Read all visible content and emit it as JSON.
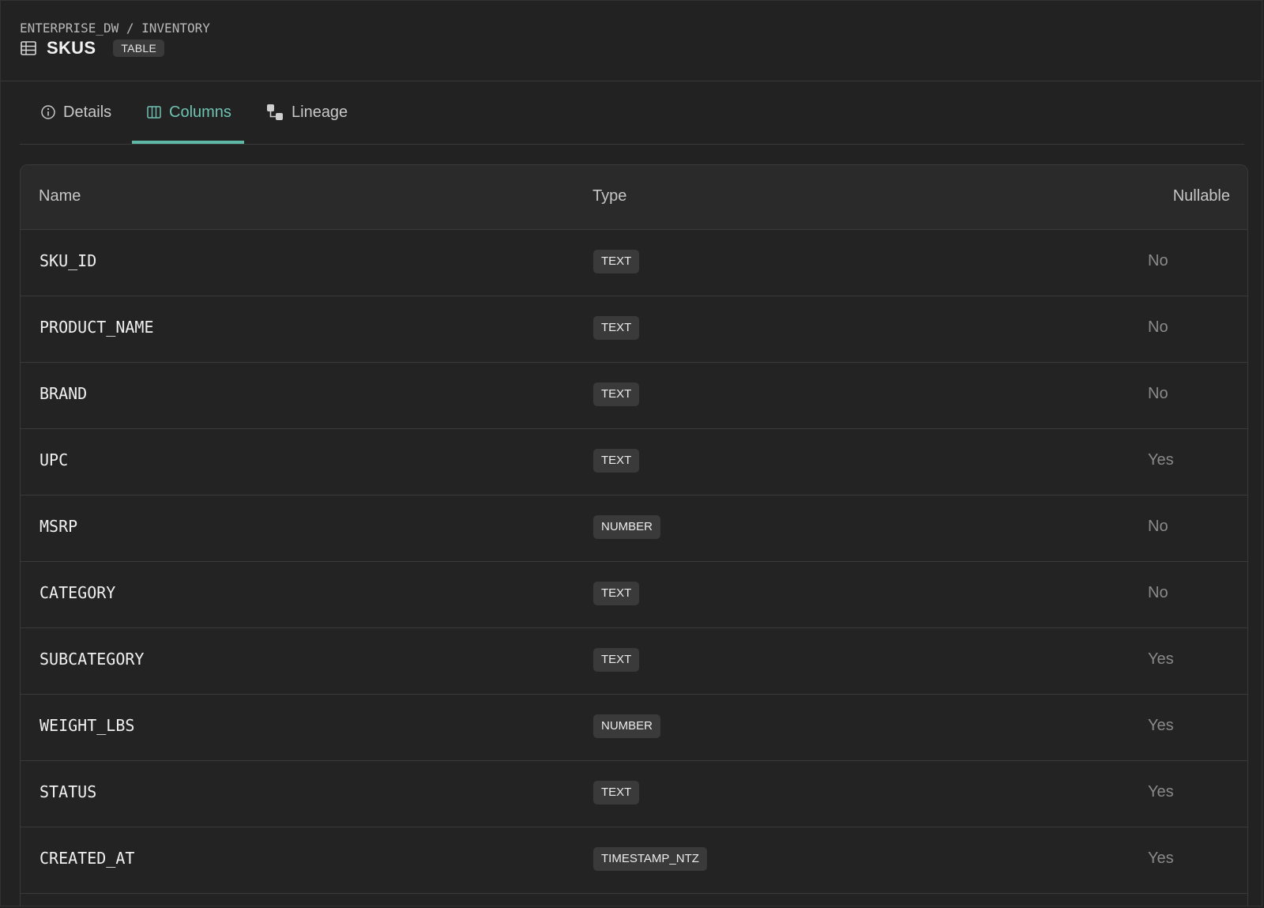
{
  "breadcrumb": {
    "database": "ENTERPRISE_DW",
    "separator": "/",
    "schema": "INVENTORY"
  },
  "header": {
    "title": "SKUS",
    "kind_badge": "TABLE",
    "icon": "table-grid-icon"
  },
  "tabs": [
    {
      "label": "Details",
      "icon": "info-circle-icon",
      "active": false
    },
    {
      "label": "Columns",
      "icon": "columns-icon",
      "active": true
    },
    {
      "label": "Lineage",
      "icon": "lineage-icon",
      "active": false
    }
  ],
  "colors": {
    "background": "#222222",
    "accent": "#5fb8a6",
    "badge_bg": "#3a3a3a",
    "muted_text": "#8a8a8a"
  },
  "columns_table": {
    "headers": {
      "name": "Name",
      "type": "Type",
      "nullable": "Nullable"
    },
    "rows": [
      {
        "name": "SKU_ID",
        "type": "TEXT",
        "nullable": "No"
      },
      {
        "name": "PRODUCT_NAME",
        "type": "TEXT",
        "nullable": "No"
      },
      {
        "name": "BRAND",
        "type": "TEXT",
        "nullable": "No"
      },
      {
        "name": "UPC",
        "type": "TEXT",
        "nullable": "Yes"
      },
      {
        "name": "MSRP",
        "type": "NUMBER",
        "nullable": "No"
      },
      {
        "name": "CATEGORY",
        "type": "TEXT",
        "nullable": "No"
      },
      {
        "name": "SUBCATEGORY",
        "type": "TEXT",
        "nullable": "Yes"
      },
      {
        "name": "WEIGHT_LBS",
        "type": "NUMBER",
        "nullable": "Yes"
      },
      {
        "name": "STATUS",
        "type": "TEXT",
        "nullable": "Yes"
      },
      {
        "name": "CREATED_AT",
        "type": "TIMESTAMP_NTZ",
        "nullable": "Yes"
      }
    ]
  }
}
